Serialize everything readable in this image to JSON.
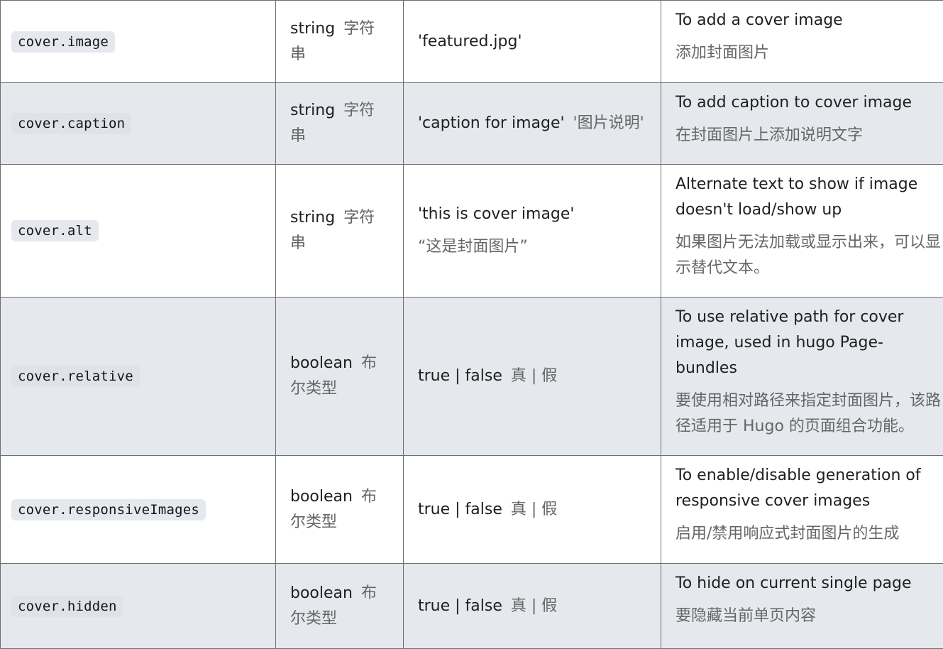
{
  "rows": [
    {
      "key": "cover.image",
      "type_en": "string",
      "type_zh": "字符串",
      "default_en": "'featured.jpg'",
      "default_zh": "",
      "desc_en": "To add a cover image",
      "desc_zh": "添加封面图片"
    },
    {
      "key": "cover.caption",
      "type_en": "string",
      "type_zh": "字符串",
      "default_en": "'caption for image'",
      "default_zh": "'图片说明'",
      "desc_en": "To add caption to cover image",
      "desc_zh": "在封面图片上添加说明文字"
    },
    {
      "key": "cover.alt",
      "type_en": "string",
      "type_zh": "字符串",
      "default_en": "'this is cover image'",
      "default_zh": "“这是封面图片”",
      "desc_en": "Alternate text to show if image doesn't load/show up",
      "desc_zh": "如果图片无法加载或显示出来，可以显示替代文本。"
    },
    {
      "key": "cover.relative",
      "type_en": "boolean",
      "type_zh": "布尔类型",
      "default_en": "true | false",
      "default_zh": "真 | 假",
      "desc_en": "To use relative path for cover image, used in hugo Page-bundles",
      "desc_zh": "要使用相对路径来指定封面图片，该路径适用于 Hugo 的页面组合功能。"
    },
    {
      "key": "cover.responsiveImages",
      "type_en": "boolean",
      "type_zh": "布尔类型",
      "default_en": "true | false",
      "default_zh": "真 | 假",
      "desc_en": "To enable/disable generation of responsive cover images",
      "desc_zh": "启用/禁用响应式封面图片的生成"
    },
    {
      "key": "cover.hidden",
      "type_en": "boolean",
      "type_zh": "布尔类型",
      "default_en": "true | false",
      "default_zh": "真 | 假",
      "desc_en": "To hide on current single page",
      "desc_zh": "要隐藏当前单页内容"
    }
  ]
}
